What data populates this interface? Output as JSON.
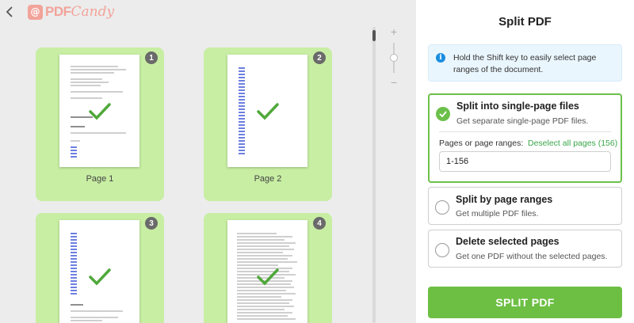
{
  "app": {
    "logo_part1": "PDF",
    "logo_part2": "Candy"
  },
  "pages": [
    {
      "number": "1",
      "label": "Page 1"
    },
    {
      "number": "2",
      "label": "Page 2"
    },
    {
      "number": "3",
      "label": ""
    },
    {
      "number": "4",
      "label": ""
    }
  ],
  "panel": {
    "title": "Split PDF",
    "info_text": "Hold the Shift key to easily select page ranges of the document.",
    "options": [
      {
        "title": "Split into single-page files",
        "subtitle": "Get separate single-page PDF files.",
        "selected": true
      },
      {
        "title": "Split by page ranges",
        "subtitle": "Get multiple PDF files.",
        "selected": false
      },
      {
        "title": "Delete selected pages",
        "subtitle": "Get one PDF without the selected pages.",
        "selected": false
      }
    ],
    "pages_label": "Pages or page ranges:",
    "deselect_link": "Deselect all pages (156)",
    "range_value": "1-156",
    "split_button": "SPLIT PDF"
  },
  "colors": {
    "accent_green": "#6dbf44",
    "card_green": "#c8eea3",
    "info_blue": "#1a8de0",
    "logo": "#f2a39a"
  }
}
